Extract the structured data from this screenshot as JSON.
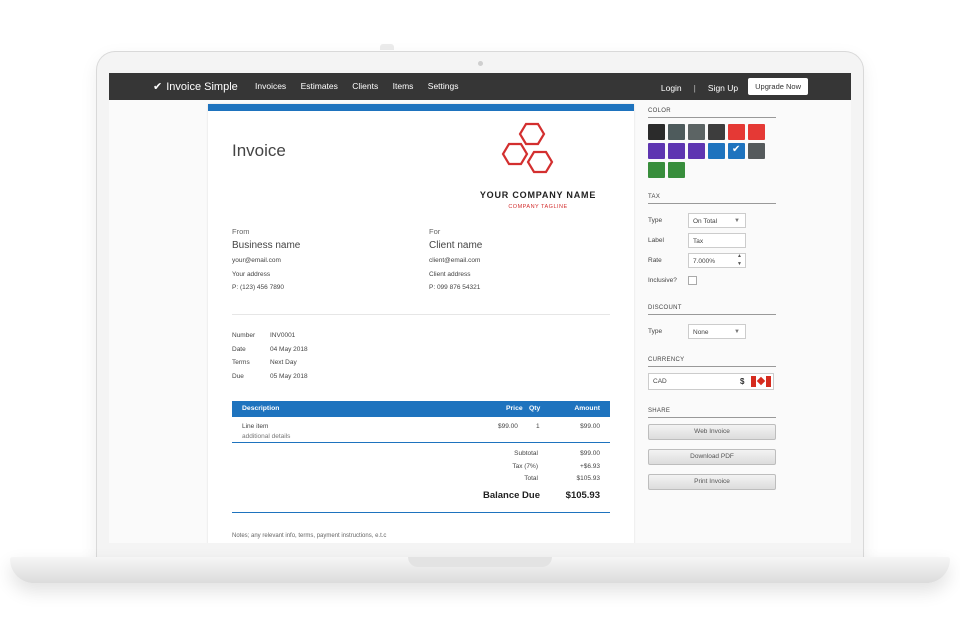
{
  "nav": {
    "brand": "Invoice Simple",
    "links": [
      "Invoices",
      "Estimates",
      "Clients",
      "Items",
      "Settings"
    ],
    "login": "Login",
    "separator": "|",
    "signup": "Sign Up",
    "upgrade": "Upgrade Now"
  },
  "invoice": {
    "title": "Invoice",
    "company_name": "YOUR COMPANY NAME",
    "company_tagline": "COMPANY TAGLINE",
    "from": {
      "heading": "From",
      "name": "Business name",
      "email": "your@email.com",
      "address": "Your address",
      "phone": "P: (123) 456 7890"
    },
    "to": {
      "heading": "For",
      "name": "Client name",
      "email": "client@email.com",
      "address": "Client address",
      "phone": "P: 099 876 54321"
    },
    "meta": {
      "number_label": "Number",
      "number": "INV0001",
      "date_label": "Date",
      "date": "04 May 2018",
      "terms_label": "Terms",
      "terms": "Next Day",
      "due_label": "Due",
      "due": "05 May 2018"
    },
    "table": {
      "headers": {
        "description": "Description",
        "price": "Price",
        "qty": "Qty",
        "amount": "Amount"
      },
      "rows": [
        {
          "description": "Line item",
          "details": "additional details",
          "price": "$99.00",
          "qty": "1",
          "amount": "$99.00"
        }
      ]
    },
    "totals": {
      "subtotal_label": "Subtotal",
      "subtotal": "$99.00",
      "tax_label": "Tax (7%)",
      "tax": "+$6.93",
      "total_label": "Total",
      "total": "$105.93",
      "balance_label": "Balance Due",
      "balance": "$105.93"
    },
    "notes": "Notes; any relevant info, terms, payment instructions, e.t.c"
  },
  "panel": {
    "color": {
      "title": "COLOR",
      "swatches": [
        "#2b2b2b",
        "#4e5b5c",
        "#5c6464",
        "#3d3d3d",
        "#e53935",
        "#e53935",
        "#5e35b1",
        "#5e35b1",
        "#5e35b1",
        "#1e73be",
        "#1e73be",
        "#555a5c",
        "#388e3c",
        "#388e3c"
      ],
      "selected_index": 10
    },
    "tax": {
      "title": "TAX",
      "type_label": "Type",
      "type_value": "On Total",
      "label_label": "Label",
      "label_value": "Tax",
      "rate_label": "Rate",
      "rate_value": "7.000%",
      "inclusive_label": "Inclusive?"
    },
    "discount": {
      "title": "DISCOUNT",
      "type_label": "Type",
      "type_value": "None"
    },
    "currency": {
      "title": "CURRENCY",
      "code": "CAD",
      "symbol": "$"
    },
    "share": {
      "title": "SHARE",
      "web": "Web Invoice",
      "pdf": "Download PDF",
      "print": "Print Invoice"
    }
  }
}
